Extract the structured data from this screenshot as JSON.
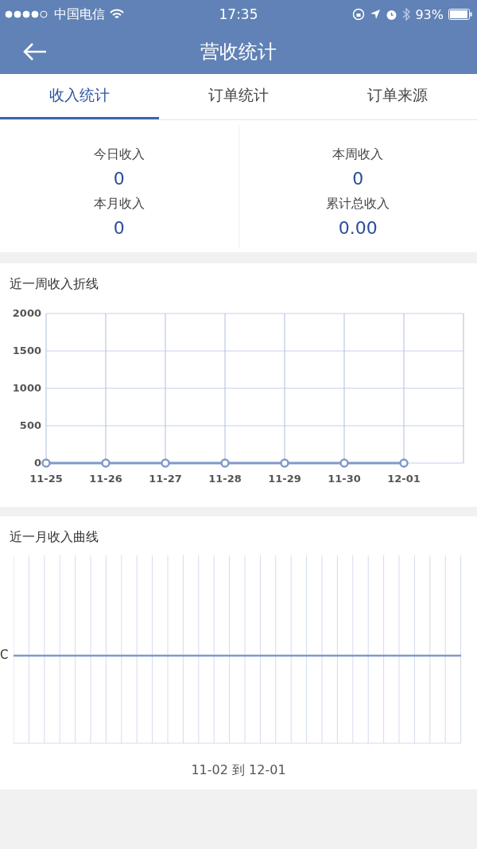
{
  "status_bar": {
    "carrier": "中国电信",
    "time": "17:35",
    "battery": "93%"
  },
  "nav": {
    "title": "营收统计"
  },
  "tabs": [
    {
      "label": "收入统计",
      "selected": true
    },
    {
      "label": "订单统计",
      "selected": false
    },
    {
      "label": "订单来源",
      "selected": false
    }
  ],
  "summary": [
    {
      "items": [
        {
          "label": "今日收入",
          "value": "0"
        },
        {
          "label": "本月收入",
          "value": "0"
        }
      ]
    },
    {
      "items": [
        {
          "label": "本周收入",
          "value": "0"
        },
        {
          "label": "累计总收入",
          "value": "0.00"
        }
      ]
    }
  ],
  "week_chart": {
    "title": "近一周收入折线",
    "chart_data": {
      "type": "line",
      "categories": [
        "11-25",
        "11-26",
        "11-27",
        "11-28",
        "11-29",
        "11-30",
        "12-01"
      ],
      "series": [
        {
          "color": "#7f99cc",
          "marker": true,
          "values": [
            0,
            0,
            0,
            0,
            0,
            0,
            0
          ]
        }
      ],
      "grid": true,
      "ylim": [
        0,
        2000
      ],
      "yticks": [
        0,
        500,
        1000,
        1500,
        2000
      ]
    }
  },
  "month_chart": {
    "title": "近一月收入曲线",
    "y_label": "C",
    "caption": "11-02 到 12-01"
  }
}
